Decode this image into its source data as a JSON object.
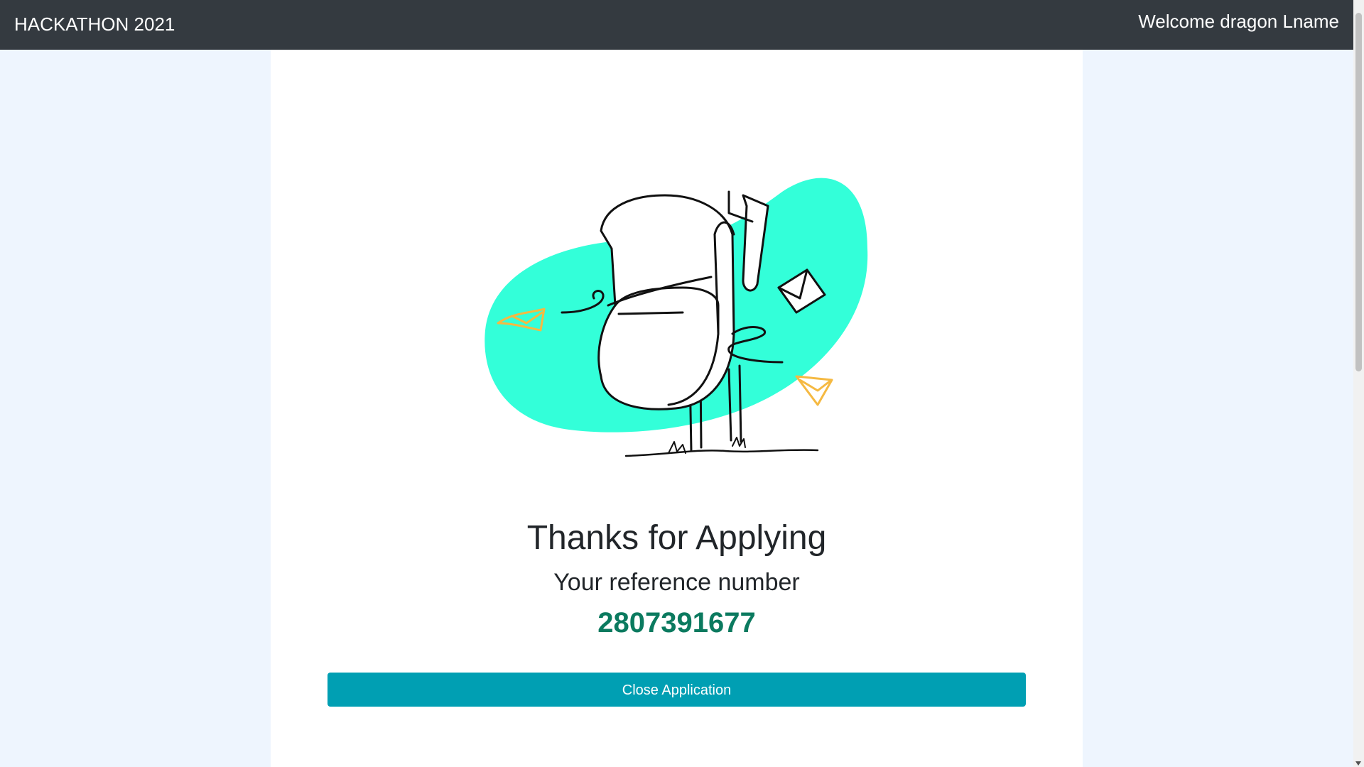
{
  "header": {
    "brand": "HACKATHON 2021",
    "welcome": "Welcome dragon Lname"
  },
  "illustration": {
    "icon": "mailbox-illustration",
    "accent_color": "#33ffd9",
    "envelope_color": "#f5b942"
  },
  "confirmation": {
    "title": "Thanks for Applying",
    "reference_label": "Your reference number",
    "reference_number": "2807391677",
    "reference_color": "#0b7a5f"
  },
  "actions": {
    "close_label": "Close Application",
    "button_color": "#009fb3"
  }
}
